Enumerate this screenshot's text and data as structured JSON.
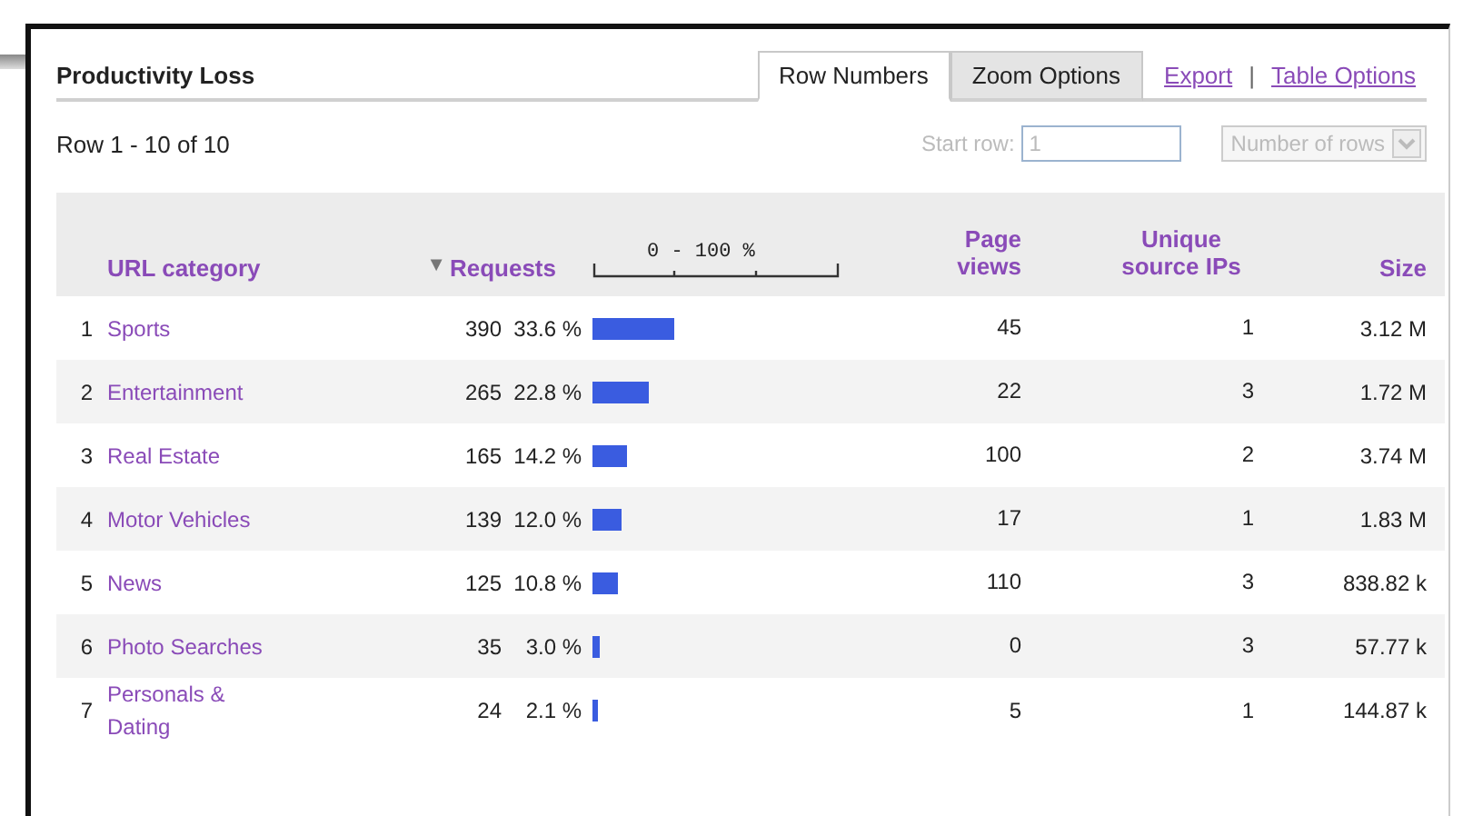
{
  "panel": {
    "title": "Productivity Loss"
  },
  "tabs": [
    {
      "label": "Row Numbers",
      "selected": true
    },
    {
      "label": "Zoom Options",
      "selected": false
    }
  ],
  "links": [
    "Export",
    "Table Options"
  ],
  "link_separator": "|",
  "row_range": "Row 1 - 10 of 10",
  "start_row": {
    "label": "Start row:",
    "value": "1",
    "disabled": true
  },
  "rows_select": {
    "placeholder": "Number of rows",
    "disabled": true
  },
  "table": {
    "header": {
      "category": "URL category",
      "sort_marker": "▼",
      "requests": "Requests",
      "scale": "0 - 100 %",
      "page_views": "Page views",
      "unique_ips": "Unique source IPs",
      "size": "Size"
    },
    "rows": [
      {
        "num": "1",
        "category": "Sports",
        "requests": "390",
        "percent": "33.6 %",
        "page_views": "45",
        "unique_ips": "1",
        "size": "3.12 M"
      },
      {
        "num": "2",
        "category": "Entertainment",
        "requests": "265",
        "percent": "22.8 %",
        "page_views": "22",
        "unique_ips": "3",
        "size": "1.72 M"
      },
      {
        "num": "3",
        "category": "Real Estate",
        "requests": "165",
        "percent": "14.2 %",
        "page_views": "100",
        "unique_ips": "2",
        "size": "3.74 M"
      },
      {
        "num": "4",
        "category": "Motor Vehicles",
        "requests": "139",
        "percent": "12.0 %",
        "page_views": "17",
        "unique_ips": "1",
        "size": "1.83 M"
      },
      {
        "num": "5",
        "category": "News",
        "requests": "125",
        "percent": "10.8 %",
        "page_views": "110",
        "unique_ips": "3",
        "size": "838.82 k"
      },
      {
        "num": "6",
        "category": "Photo Searches",
        "requests": "35",
        "percent": "3.0 %",
        "page_views": "0",
        "unique_ips": "3",
        "size": "57.77 k"
      },
      {
        "num": "7",
        "category": "Personals & Dating",
        "requests": "24",
        "percent": "2.1 %",
        "page_views": "5",
        "unique_ips": "1",
        "size": "144.87 k"
      }
    ]
  }
}
